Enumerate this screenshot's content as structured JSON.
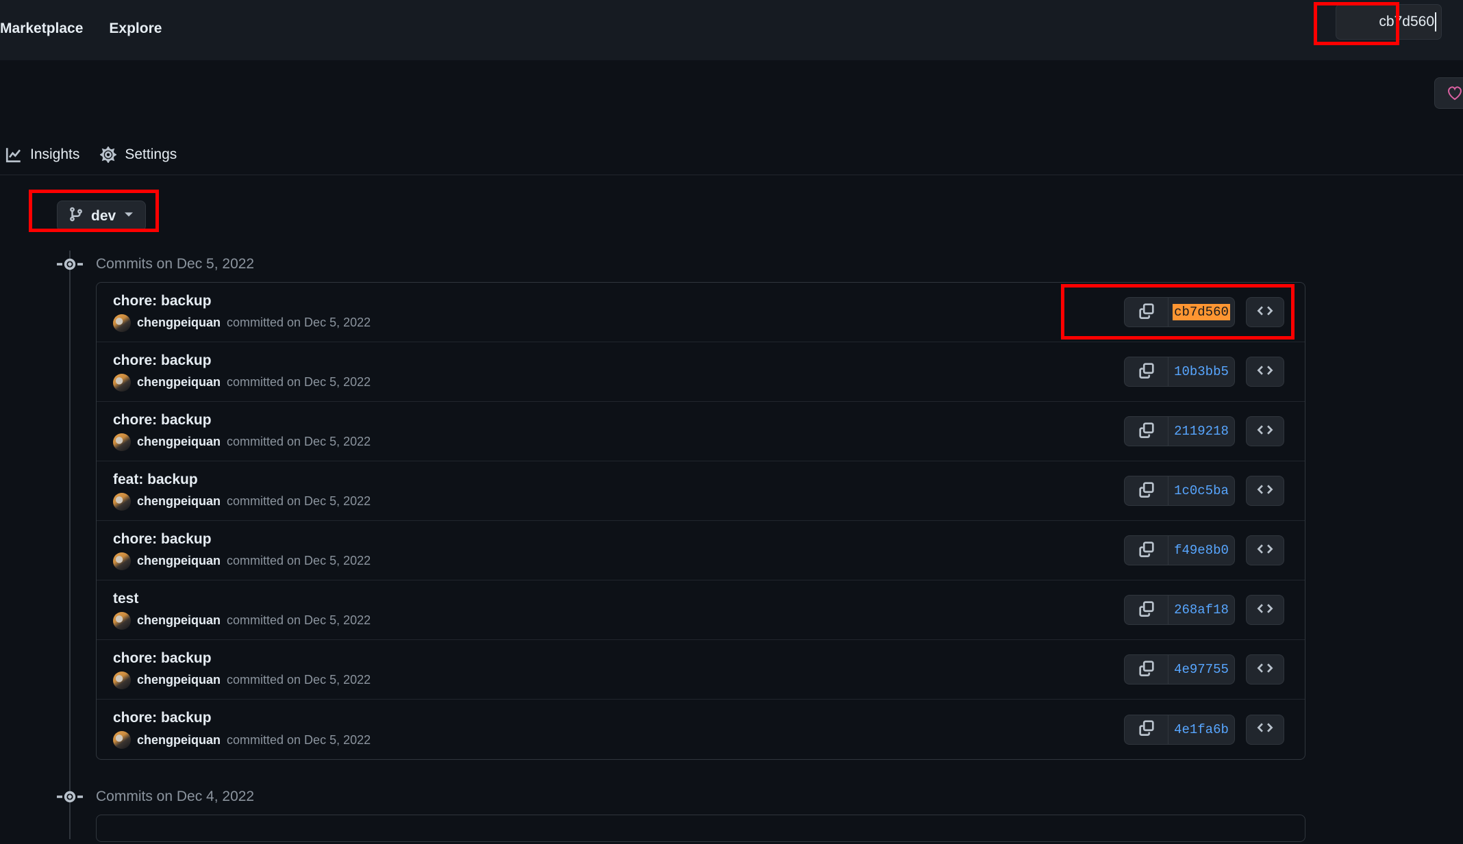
{
  "header": {
    "nav_items": [
      {
        "label": "Marketplace",
        "name": "nav-marketplace"
      },
      {
        "label": "Explore",
        "name": "nav-explore"
      }
    ],
    "search": {
      "value": "cb7d560",
      "placeholder": "Search"
    }
  },
  "sponsor": {
    "icon": "heart-icon",
    "color": "#db61a2"
  },
  "tabs": [
    {
      "label": "Insights",
      "icon": "graph-icon"
    },
    {
      "label": "Settings",
      "icon": "gear-icon"
    }
  ],
  "branch_selector": {
    "label": "dev",
    "icon": "git-branch-icon",
    "chevron": "chevron-down-icon"
  },
  "colors": {
    "page_background": "#0d1117",
    "header_background": "#161b22",
    "border": "#30363d",
    "link": "#58a6ff",
    "muted_text": "#8b949e",
    "primary_text": "#e6edf3",
    "annotation": "#ff0000",
    "search_highlight": "#ff9632"
  },
  "commit_groups": [
    {
      "title": "Commits on Dec 5, 2022",
      "commits": [
        {
          "message": "chore: backup",
          "author": "chengpeiquan",
          "committed_text": "committed on Dec 5, 2022",
          "sha": "cb7d560",
          "highlighted": true
        },
        {
          "message": "chore: backup",
          "author": "chengpeiquan",
          "committed_text": "committed on Dec 5, 2022",
          "sha": "10b3bb5",
          "highlighted": false
        },
        {
          "message": "chore: backup",
          "author": "chengpeiquan",
          "committed_text": "committed on Dec 5, 2022",
          "sha": "2119218",
          "highlighted": false
        },
        {
          "message": "feat: backup",
          "author": "chengpeiquan",
          "committed_text": "committed on Dec 5, 2022",
          "sha": "1c0c5ba",
          "highlighted": false
        },
        {
          "message": "chore: backup",
          "author": "chengpeiquan",
          "committed_text": "committed on Dec 5, 2022",
          "sha": "f49e8b0",
          "highlighted": false
        },
        {
          "message": "test",
          "author": "chengpeiquan",
          "committed_text": "committed on Dec 5, 2022",
          "sha": "268af18",
          "highlighted": false
        },
        {
          "message": "chore: backup",
          "author": "chengpeiquan",
          "committed_text": "committed on Dec 5, 2022",
          "sha": "4e97755",
          "highlighted": false
        },
        {
          "message": "chore: backup",
          "author": "chengpeiquan",
          "committed_text": "committed on Dec 5, 2022",
          "sha": "4e1fa6b",
          "highlighted": false
        }
      ]
    },
    {
      "title": "Commits on Dec 4, 2022",
      "commits": []
    }
  ]
}
